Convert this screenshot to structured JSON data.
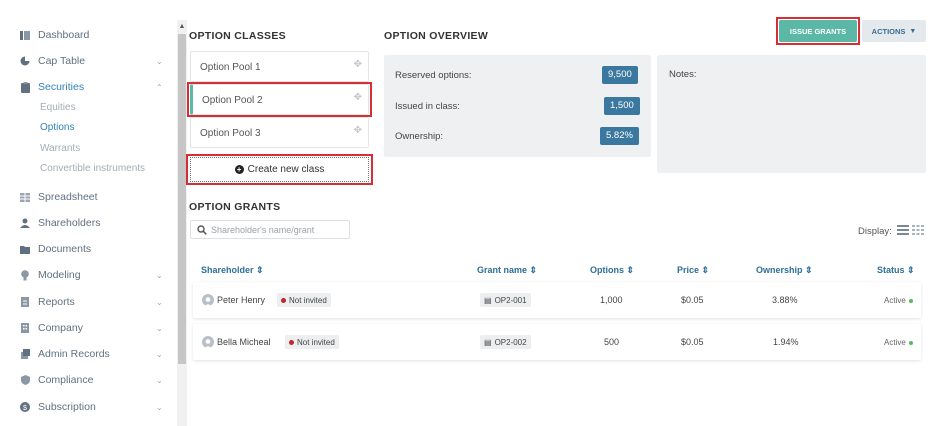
{
  "sidebar": {
    "items": [
      {
        "label": "Dashboard",
        "icon": "dashboard-icon"
      },
      {
        "label": "Cap Table",
        "icon": "pie-chart-icon",
        "chevron": "⌄"
      },
      {
        "label": "Securities",
        "icon": "clipboard-icon",
        "chevron": "⌃"
      },
      {
        "label": "Spreadsheet",
        "icon": "grid-icon"
      },
      {
        "label": "Shareholders",
        "icon": "person-icon"
      },
      {
        "label": "Documents",
        "icon": "folder-icon"
      },
      {
        "label": "Modeling",
        "icon": "lightbulb-icon",
        "chevron": "⌄"
      },
      {
        "label": "Reports",
        "icon": "report-icon",
        "chevron": "⌄"
      },
      {
        "label": "Company",
        "icon": "building-icon",
        "chevron": "⌄"
      },
      {
        "label": "Admin Records",
        "icon": "admin-icon",
        "chevron": "⌄"
      },
      {
        "label": "Compliance",
        "icon": "shield-icon",
        "chevron": "⌄"
      },
      {
        "label": "Subscription",
        "icon": "dollar-icon",
        "chevron": "⌄"
      }
    ],
    "securities_sub": [
      "Equities",
      "Options",
      "Warrants",
      "Convertible instruments"
    ]
  },
  "option_classes": {
    "title": "OPTION CLASSES",
    "items": [
      "Option Pool 1",
      "Option Pool 2",
      "Option Pool 3"
    ],
    "create_label": "Create new class"
  },
  "overview": {
    "title": "OPTION OVERVIEW",
    "reserved_label": "Reserved options:",
    "reserved_value": "9,500",
    "issued_label": "Issued in class:",
    "issued_value": "1,500",
    "ownership_label": "Ownership:",
    "ownership_value": "5.82%",
    "notes_label": "Notes:"
  },
  "toolbar": {
    "issue_label": "ISSUE GRANTS",
    "actions_label": "ACTIONS"
  },
  "grants": {
    "title": "OPTION GRANTS",
    "search_placeholder": "Shareholder's name/grant",
    "display_label": "Display:",
    "headers": {
      "shareholder": "Shareholder",
      "grant": "Grant name",
      "options": "Options",
      "price": "Price",
      "ownership": "Ownership",
      "status": "Status"
    },
    "rows": [
      {
        "name": "Peter Henry",
        "invite": "Not invited",
        "grant": "OP2-001",
        "options": "1,000",
        "price": "$0.05",
        "ownership": "3.88%",
        "status": "Active"
      },
      {
        "name": "Bella Micheal",
        "invite": "Not invited",
        "grant": "OP2-002",
        "options": "500",
        "price": "$0.05",
        "ownership": "1.94%",
        "status": "Active"
      }
    ]
  },
  "colors": {
    "accent": "#5cb8a6",
    "badge": "#3a78a0",
    "link": "#2f82b8",
    "highlight": "#d62e35"
  }
}
